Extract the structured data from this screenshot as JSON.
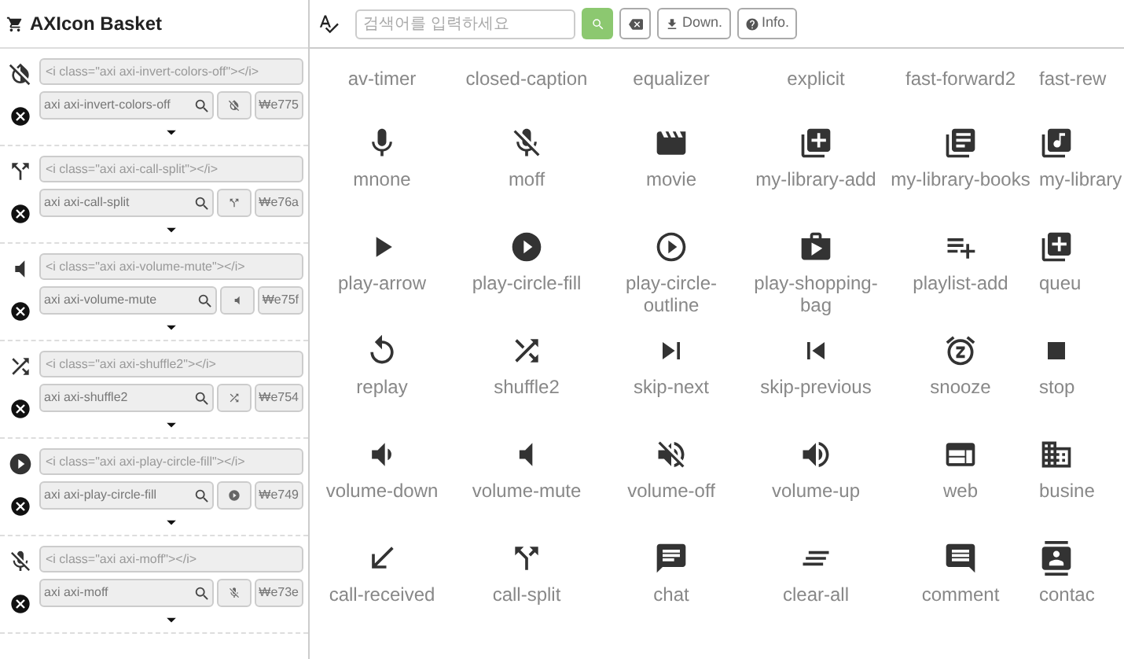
{
  "sidebar": {
    "title": "AXIcon Basket",
    "items": [
      {
        "code": "<i class=\"axi axi-invert-colors-off\"></i>",
        "class_name": "axi axi-invert-colors-off",
        "unicode": "₩e775"
      },
      {
        "code": "<i class=\"axi axi-call-split\"></i>",
        "class_name": "axi axi-call-split",
        "unicode": "₩e76a"
      },
      {
        "code": "<i class=\"axi axi-volume-mute\"></i>",
        "class_name": "axi axi-volume-mute",
        "unicode": "₩e75f"
      },
      {
        "code": "<i class=\"axi axi-shuffle2\"></i>",
        "class_name": "axi axi-shuffle2",
        "unicode": "₩e754"
      },
      {
        "code": "<i class=\"axi axi-play-circle-fill\"></i>",
        "class_name": "axi axi-play-circle-fill",
        "unicode": "₩e749"
      },
      {
        "code": "<i class=\"axi axi-moff\"></i>",
        "class_name": "axi axi-moff",
        "unicode": "₩e73e"
      }
    ]
  },
  "toolbar": {
    "placeholder": "검색어를 입력하세요",
    "buttons": [
      "Down.",
      "Info."
    ]
  },
  "icon_grid": {
    "rows": [
      [
        "av-timer",
        "closed-caption",
        "equalizer",
        "explicit",
        "fast-forward2",
        "fast-rew"
      ],
      [
        "mnone",
        "moff",
        "movie",
        "my-library-add",
        "my-library-books",
        "my-library"
      ],
      [
        "play-arrow",
        "play-circle-fill",
        "play-circle-outline",
        "play-shopping-bag",
        "playlist-add",
        "queu"
      ],
      [
        "replay",
        "shuffle2",
        "skip-next",
        "skip-previous",
        "snooze",
        "stop"
      ],
      [
        "volume-down",
        "volume-mute",
        "volume-off",
        "volume-up",
        "web",
        "busine"
      ],
      [
        "call-received",
        "call-split",
        "chat",
        "clear-all",
        "comment",
        "contac"
      ]
    ]
  }
}
